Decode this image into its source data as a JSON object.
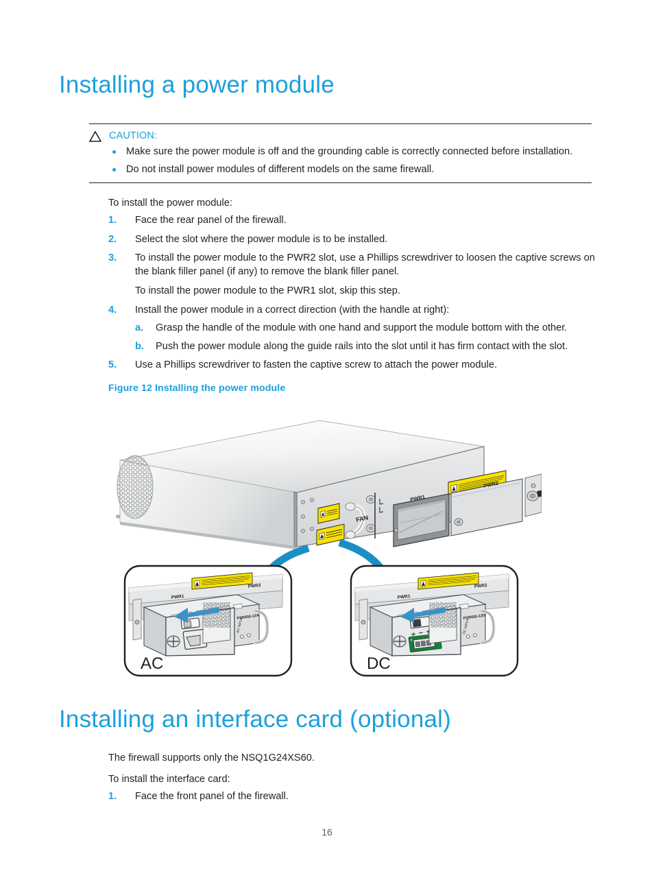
{
  "document": {
    "page_number": "16"
  },
  "sections": {
    "power_module": {
      "title": "Installing a power module",
      "caution": {
        "label": "CAUTION:",
        "icon": "caution-triangle-icon",
        "items": [
          "Make sure the power module is off and the grounding cable is correctly connected before installation.",
          "Do not install power modules of different models on the same firewall."
        ]
      },
      "intro": "To install the power module:",
      "steps": [
        {
          "num": "1.",
          "text": "Face the rear panel of the firewall."
        },
        {
          "num": "2.",
          "text": "Select the slot where the power module is to be installed."
        },
        {
          "num": "3.",
          "text": "To install the power module to the PWR2 slot, use a Phillips screwdriver to loosen the captive screws on the blank filler panel (if any) to remove the blank filler panel.",
          "extra": "To install the power module to the PWR1 slot, skip this step."
        },
        {
          "num": "4.",
          "text": "Install the power module in a correct direction (with the handle at right):",
          "substeps": [
            {
              "num": "a.",
              "text": "Grasp the handle of the module with one hand and support the module bottom with the other."
            },
            {
              "num": "b.",
              "text": "Push the power module along the guide rails into the slot until it has firm contact with the slot."
            }
          ]
        },
        {
          "num": "5.",
          "text": "Use a Phillips screwdriver to fasten the captive screw to attach the power module."
        }
      ],
      "figure": {
        "caption": "Figure 12 Installing the power module",
        "labels": {
          "fan": "FAN",
          "pwr1": "PWR1",
          "pwr2": "PWR2",
          "ac": "AC",
          "dc": "DC"
        },
        "colors": {
          "arrow_blue": "#1b8fc4",
          "chassis_light": "#e8e9ea",
          "chassis_mid": "#d3d5d7",
          "chassis_dark": "#b9bcbe",
          "outline": "#231f20",
          "warning_yellow": "#f6e200",
          "ground_green": "#0f9b3a",
          "ground_yellow": "#f2e000",
          "pcb_green": "#12803c"
        }
      }
    },
    "interface_card": {
      "title": "Installing an interface card (optional)",
      "support_note": "The firewall supports only the NSQ1G24XS60.",
      "intro": "To install the interface card:",
      "steps": [
        {
          "num": "1.",
          "text": "Face the front panel of the firewall."
        }
      ]
    }
  },
  "theme": {
    "heading_blue": "#1ba0dc",
    "body_black": "#231f20"
  }
}
